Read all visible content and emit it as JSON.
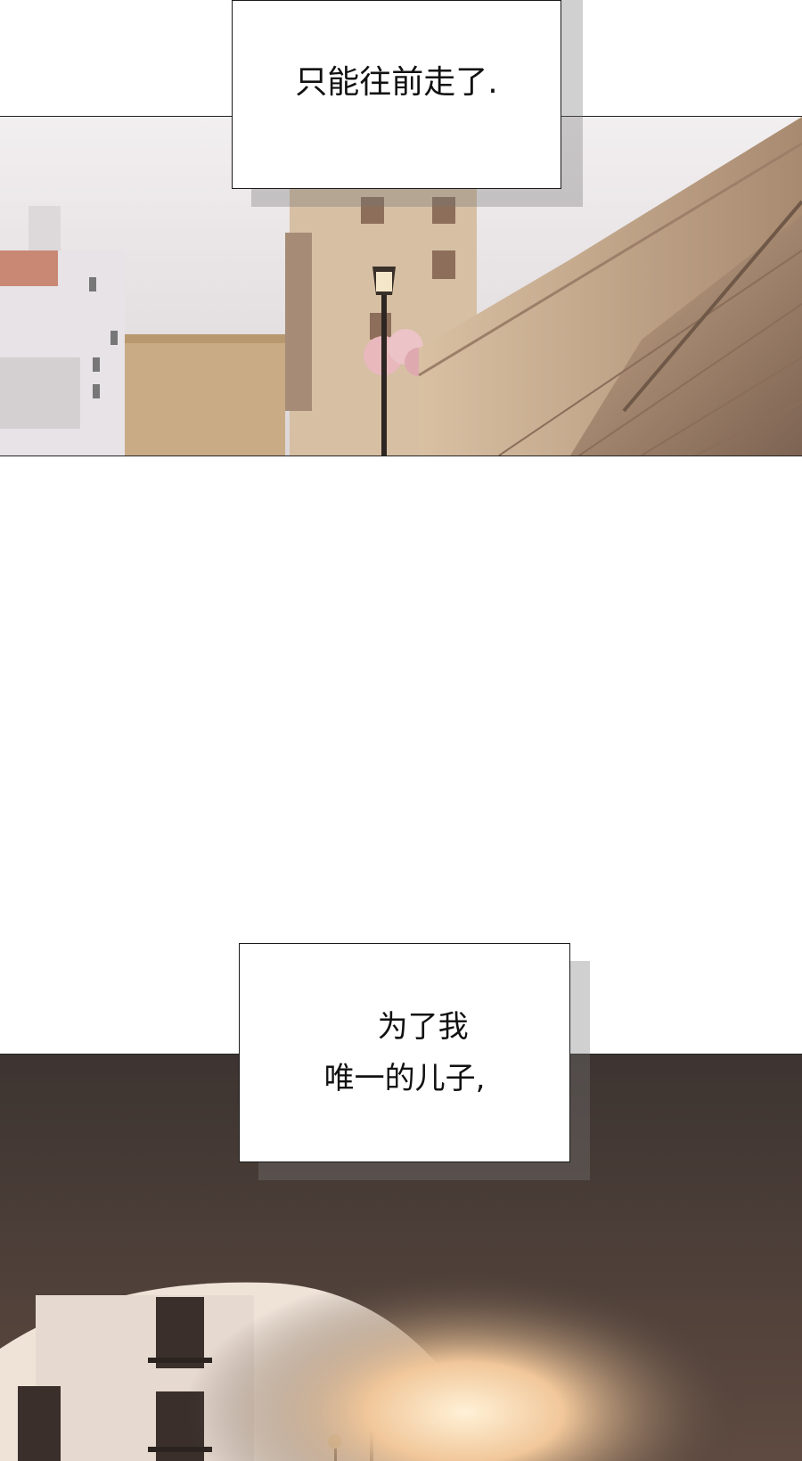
{
  "panels": [
    {
      "scene": "old-town street with stone stairway and lamp post",
      "colors": {
        "sky": "#e9e4e6",
        "stone": "#c9ab8c",
        "shadow": "#8a6f5a"
      }
    },
    {
      "scene": "stone archway opening onto a sunlit street",
      "colors": {
        "arch": "#4a3e39",
        "light": "#f6e6d0",
        "glow": "#ffd9a0"
      }
    }
  ],
  "captions": [
    {
      "lines": [
        "只能往前走了."
      ]
    },
    {
      "lines": [
        "为了我",
        "唯一的儿子,"
      ]
    }
  ]
}
